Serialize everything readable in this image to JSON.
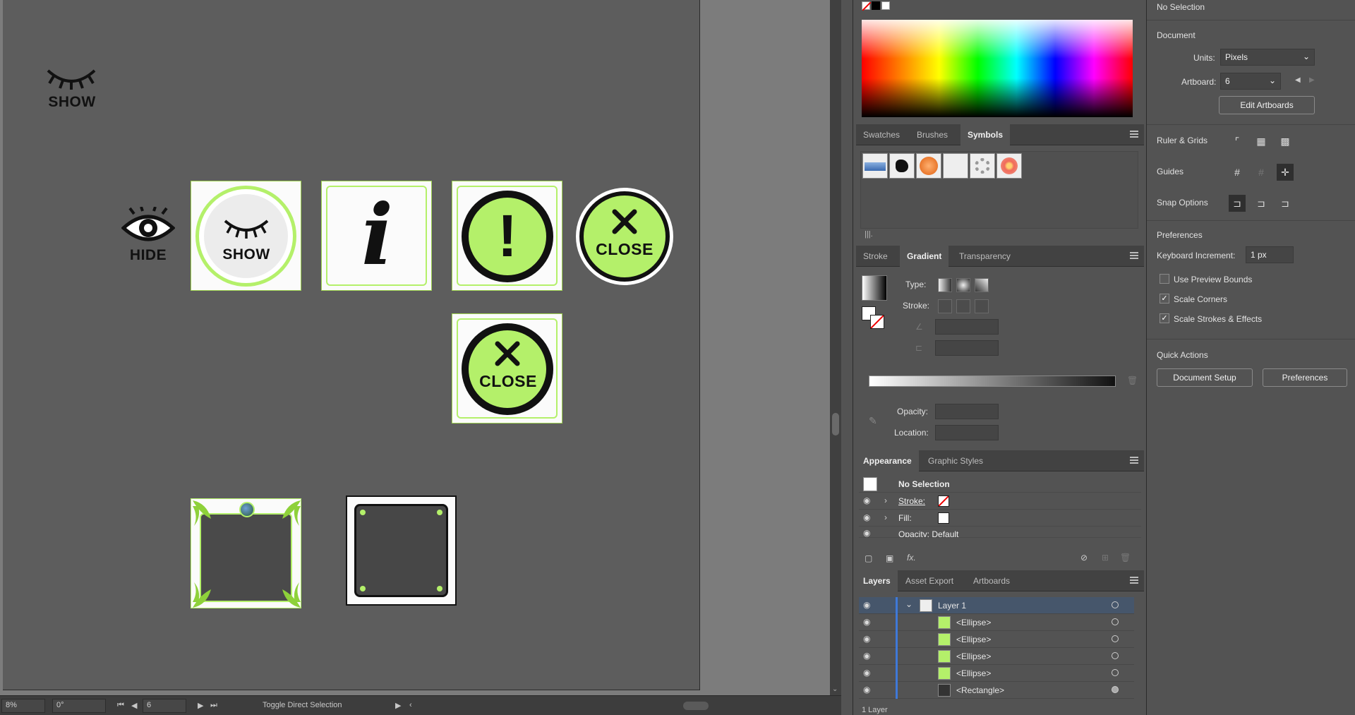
{
  "canvas": {
    "show_top_label": "SHOW",
    "hide_label": "HIDE",
    "card_show_label": "SHOW",
    "card_info_glyph": "i",
    "card_alert_glyph": "!",
    "close_label": "CLOSE",
    "close_card_label": "CLOSE",
    "accent_green": "#b4f06a"
  },
  "statusbar": {
    "zoom": "8%",
    "rotation": "0°",
    "artboard_num": "6",
    "tool_hint": "Toggle Direct Selection"
  },
  "symbols_panel": {
    "tabs": [
      "Swatches",
      "Brushes",
      "Symbols"
    ],
    "active_tab": "Symbols"
  },
  "gradient_panel": {
    "tabs": [
      "Stroke",
      "Gradient",
      "Transparency"
    ],
    "active_tab": "Gradient",
    "type_label": "Type:",
    "stroke_label": "Stroke:",
    "opacity_label": "Opacity:",
    "location_label": "Location:"
  },
  "appearance_panel": {
    "tabs": [
      "Appearance",
      "Graphic Styles"
    ],
    "active_tab": "Appearance",
    "title": "No Selection",
    "stroke_label": "Stroke:",
    "fill_label": "Fill:",
    "opacity_label": "Opacity: Default",
    "fx_label": "fx."
  },
  "layers_panel": {
    "tabs": [
      "Layers",
      "Asset Export",
      "Artboards"
    ],
    "active_tab": "Layers",
    "layer_name": "Layer 1",
    "items": [
      "<Ellipse>",
      "<Ellipse>",
      "<Ellipse>",
      "<Ellipse>",
      "<Rectangle>"
    ],
    "footer_count": "1 Layer"
  },
  "properties": {
    "selection": "No Selection",
    "document_heading": "Document",
    "units_label": "Units:",
    "units_value": "Pixels",
    "artboard_label": "Artboard:",
    "artboard_value": "6",
    "edit_artboards": "Edit Artboards",
    "ruler_grids": "Ruler & Grids",
    "guides": "Guides",
    "snap_options": "Snap Options",
    "preferences_heading": "Preferences",
    "keyboard_increment_label": "Keyboard Increment:",
    "keyboard_increment_value": "1 px",
    "use_preview_bounds": "Use Preview Bounds",
    "scale_corners": "Scale Corners",
    "scale_strokes": "Scale Strokes & Effects",
    "quick_actions": "Quick Actions",
    "document_setup": "Document Setup",
    "preferences_btn": "Preferences"
  }
}
